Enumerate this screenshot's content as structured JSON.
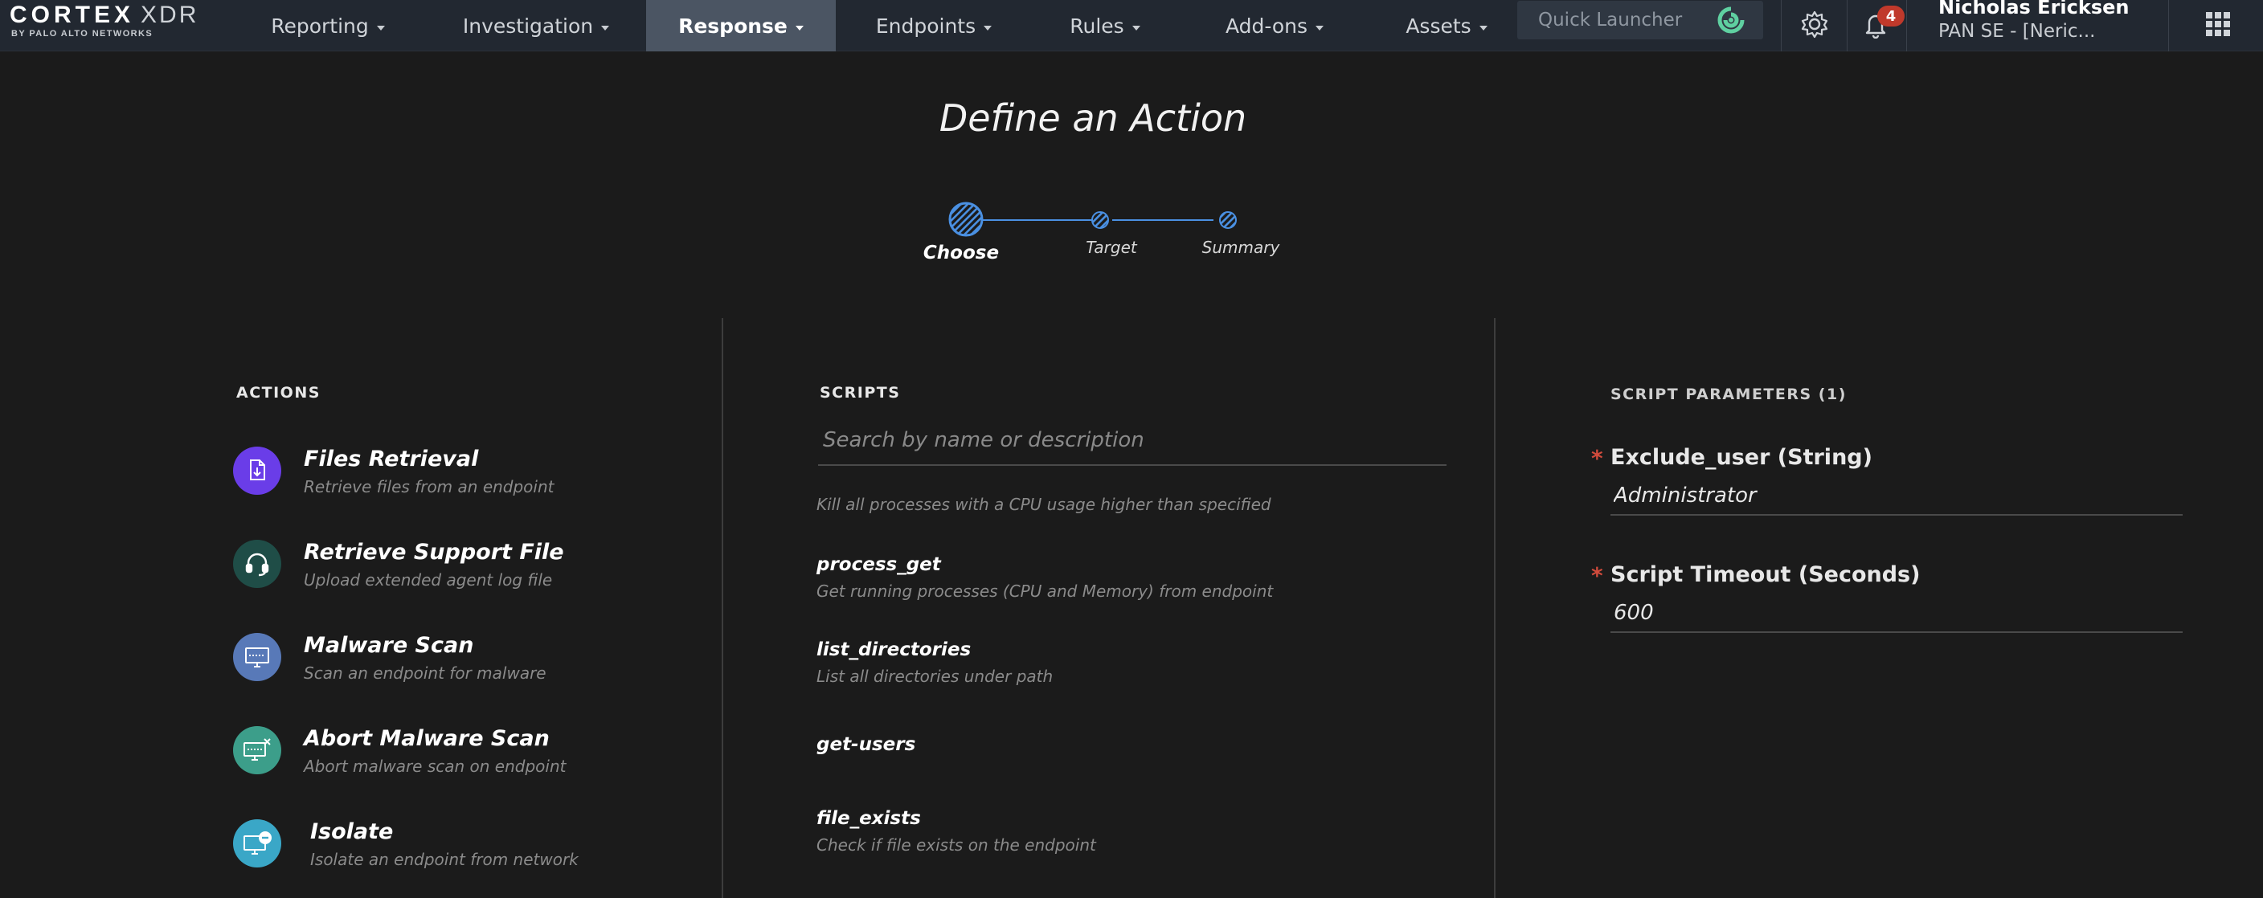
{
  "brand": {
    "name": "CORTEX",
    "product": "XDR",
    "tagline": "BY PALO ALTO NETWORKS"
  },
  "nav": {
    "items": [
      {
        "label": "Reporting",
        "active": false
      },
      {
        "label": "Investigation",
        "active": false
      },
      {
        "label": "Response",
        "active": true
      },
      {
        "label": "Endpoints",
        "active": false
      },
      {
        "label": "Rules",
        "active": false
      },
      {
        "label": "Add-ons",
        "active": false
      },
      {
        "label": "Assets",
        "active": false
      }
    ],
    "quick_launcher": {
      "placeholder": "Quick Launcher",
      "icon": "quick-launcher-icon"
    },
    "settings_icon": "gear-icon",
    "notifications": {
      "icon": "bell-icon",
      "count": "4"
    },
    "user": {
      "name": "Nicholas Ericksen",
      "tenant": "PAN SE - [Neric..."
    },
    "apps_icon": "grid-icon"
  },
  "wizard": {
    "title": "Define an Action",
    "steps": [
      {
        "label": "Choose",
        "active": true
      },
      {
        "label": "Target",
        "active": false
      },
      {
        "label": "Summary",
        "active": false
      }
    ]
  },
  "actions": {
    "heading": "ACTIONS",
    "items": [
      {
        "title": "Files Retrieval",
        "desc": "Retrieve files from an endpoint",
        "icon": "file-retrieval-icon",
        "color": "#6a3de8"
      },
      {
        "title": "Retrieve Support File",
        "desc": "Upload extended agent log file",
        "icon": "headset-icon",
        "color": "#1f4d47"
      },
      {
        "title": "Malware Scan",
        "desc": "Scan an endpoint for malware",
        "icon": "scan-monitor-icon",
        "color": "#5879b8"
      },
      {
        "title": "Abort Malware Scan",
        "desc": "Abort malware scan on endpoint",
        "icon": "abort-scan-icon",
        "color": "#3c9e8a"
      },
      {
        "title": "Isolate",
        "desc": "Isolate an endpoint from network",
        "icon": "isolate-monitor-icon",
        "color": "#3aa7c7"
      }
    ]
  },
  "scripts": {
    "heading": "SCRIPTS",
    "search_placeholder": "Search by name or description",
    "partial_desc": "Kill all processes with a CPU usage higher than specified",
    "items": [
      {
        "name": "process_get",
        "desc": "Get running processes (CPU and Memory) from endpoint"
      },
      {
        "name": "list_directories",
        "desc": "List all directories under path"
      },
      {
        "name": "get-users",
        "desc": ""
      },
      {
        "name": "file_exists",
        "desc": "Check if file exists on the endpoint"
      }
    ]
  },
  "parameters": {
    "heading": "SCRIPT PARAMETERS (1)",
    "items": [
      {
        "label": "Exclude_user (String)",
        "value": "Administrator",
        "required": true
      },
      {
        "label": "Script Timeout (Seconds)",
        "value": "600",
        "required": true
      }
    ]
  },
  "colors": {
    "accent": "#4a90e2",
    "required": "#d14b3c",
    "background": "#1b1b1b",
    "topbar": "#222831"
  }
}
